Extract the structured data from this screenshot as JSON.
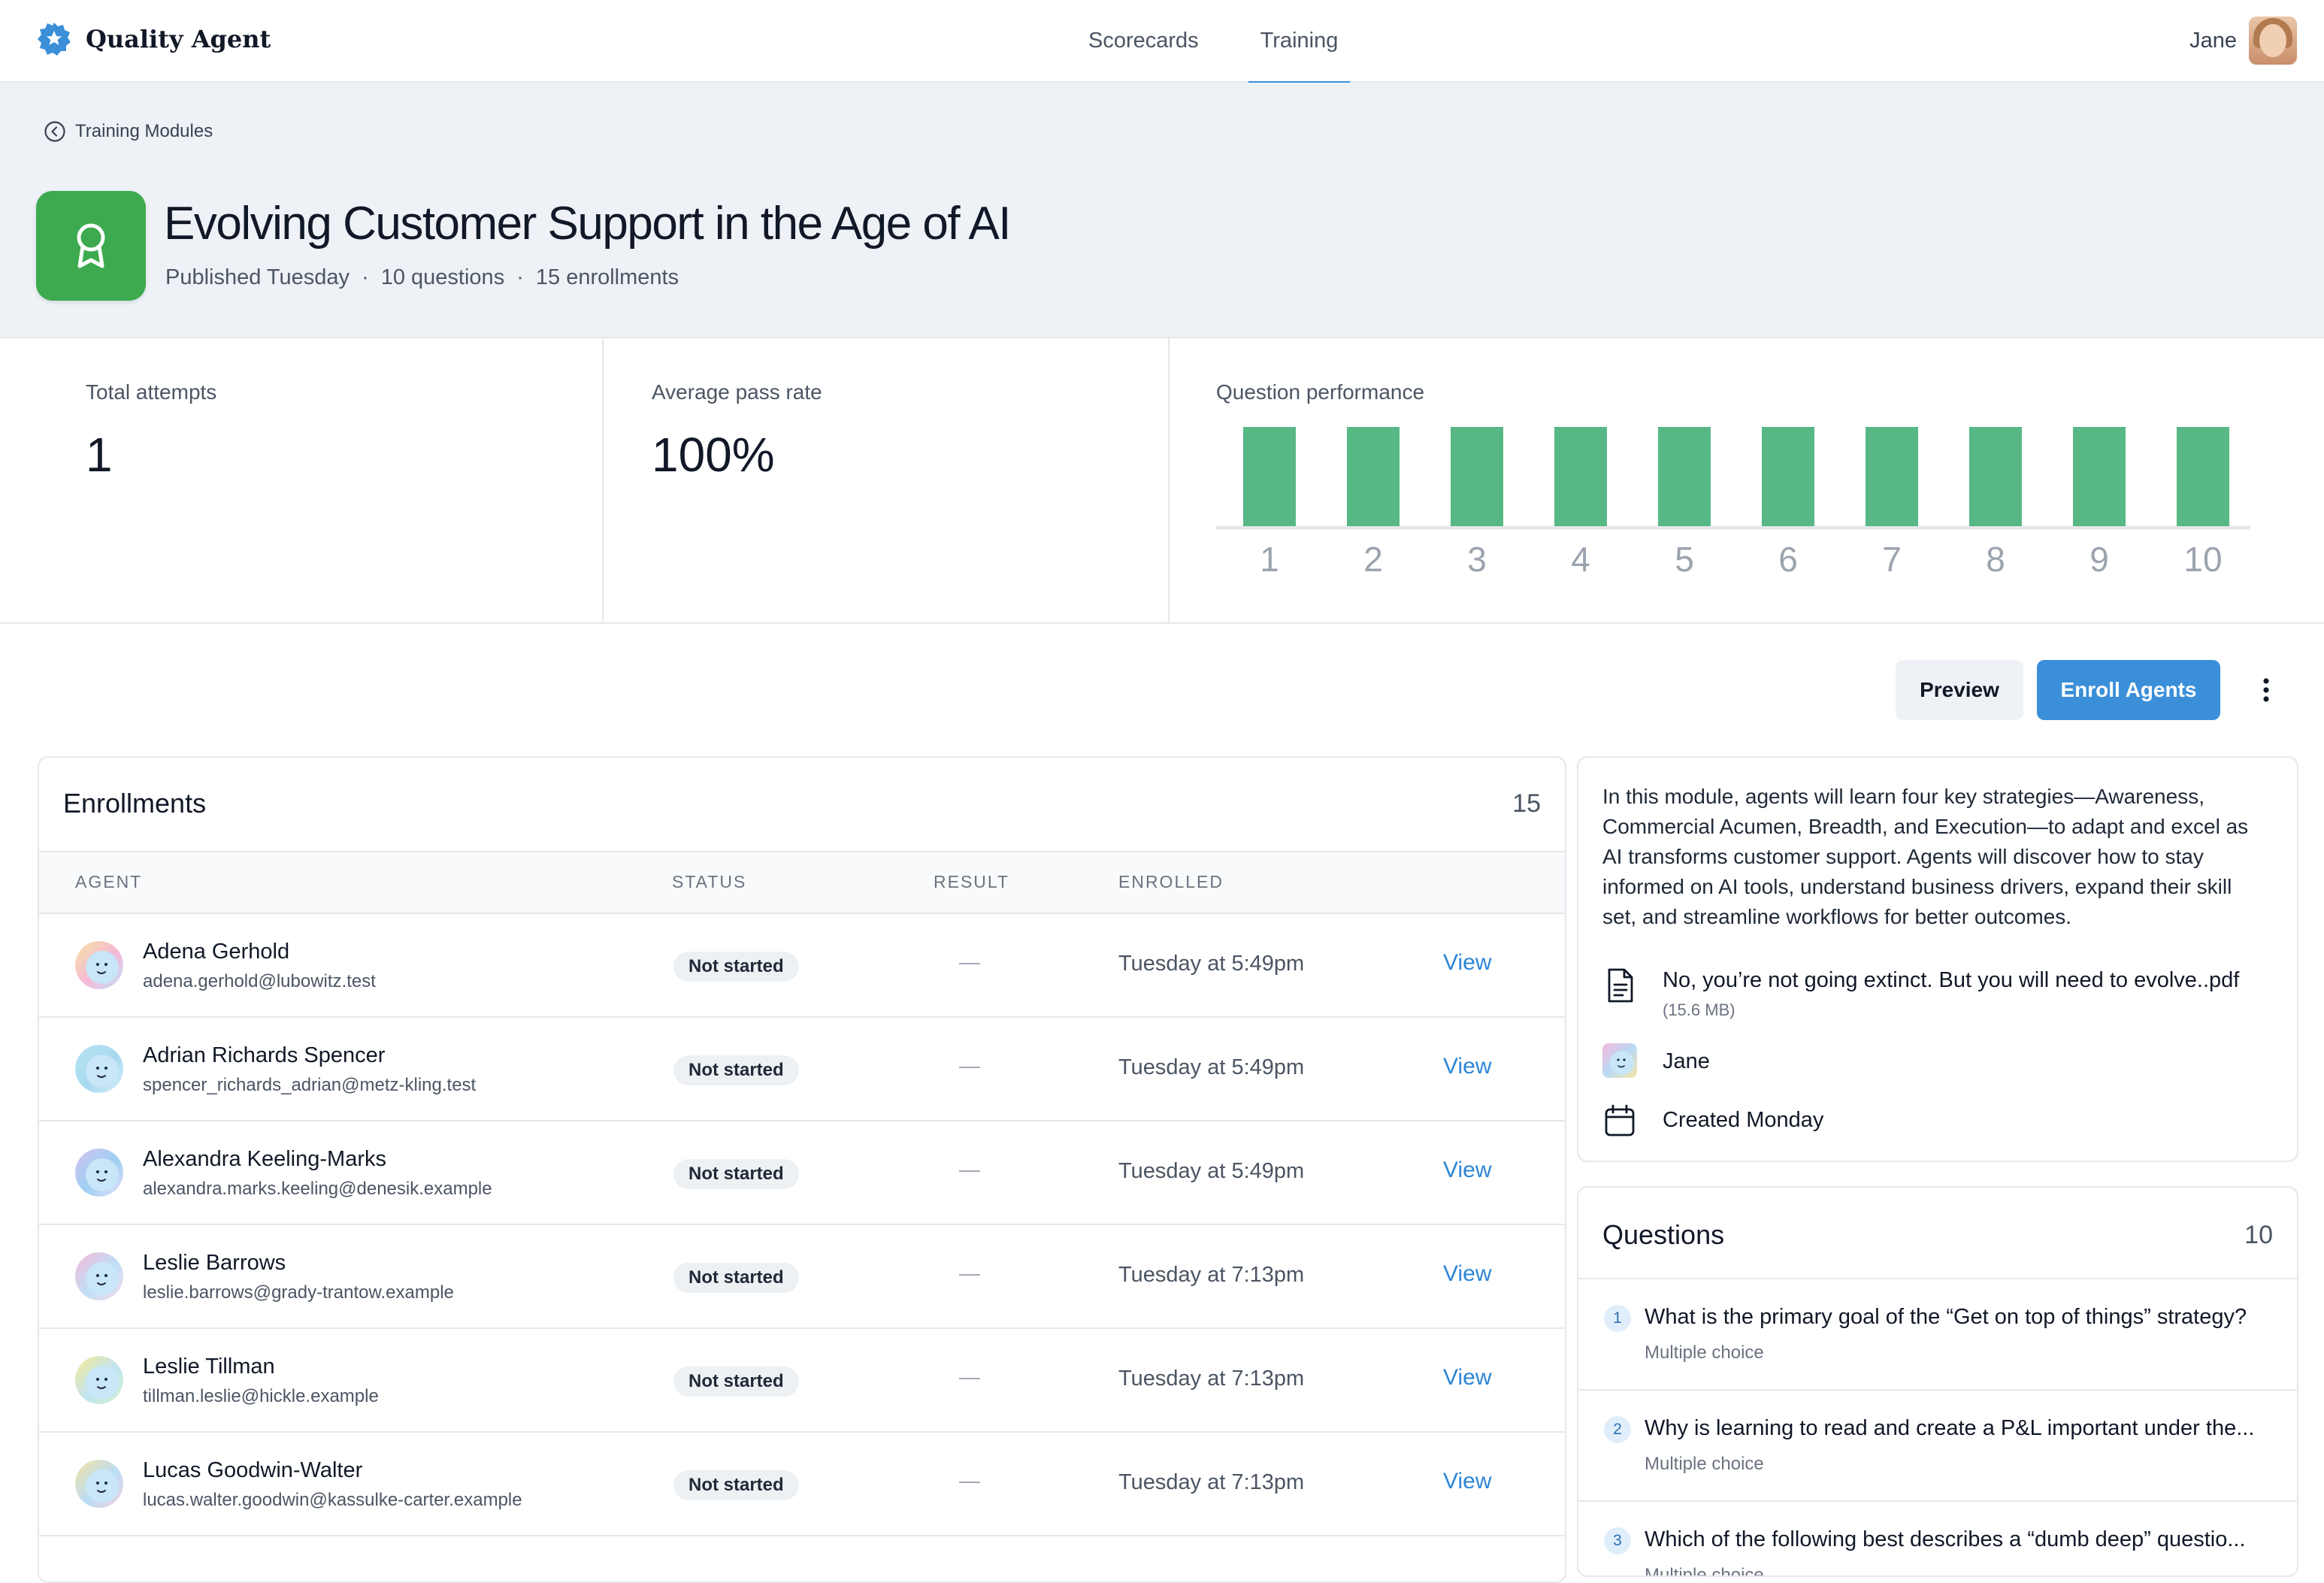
{
  "app": {
    "name": "Quality Agent"
  },
  "nav": {
    "tabs": [
      {
        "label": "Scorecards"
      },
      {
        "label": "Training"
      }
    ]
  },
  "user": {
    "name": "Jane"
  },
  "breadcrumb": {
    "label": "Training Modules"
  },
  "module": {
    "title": "Evolving Customer Support in the Age of AI",
    "published": "Published Tuesday",
    "questions": "10 questions",
    "enrollments": "15 enrollments"
  },
  "stats": {
    "total_attempts_label": "Total attempts",
    "total_attempts_value": "1",
    "pass_rate_label": "Average pass rate",
    "pass_rate_value": "100%",
    "question_performance_label": "Question performance"
  },
  "chart_data": {
    "type": "bar",
    "categories": [
      "1",
      "2",
      "3",
      "4",
      "5",
      "6",
      "7",
      "8",
      "9",
      "10"
    ],
    "values": [
      100,
      100,
      100,
      100,
      100,
      100,
      100,
      100,
      100,
      100
    ],
    "ylim": [
      0,
      100
    ],
    "title": "Question performance",
    "color": "#57b885"
  },
  "actions": {
    "preview": "Preview",
    "enroll": "Enroll Agents"
  },
  "enrollments": {
    "title": "Enrollments",
    "count": "15",
    "columns": [
      "AGENT",
      "STATUS",
      "RESULT",
      "ENROLLED"
    ],
    "rows": [
      {
        "name": "Adena Gerhold",
        "email": "adena.gerhold@lubowitz.test",
        "status": "Not started",
        "result": "—",
        "enrolled": "Tuesday at 5:49pm",
        "action": "View"
      },
      {
        "name": "Adrian Richards Spencer",
        "email": "spencer_richards_adrian@metz-kling.test",
        "status": "Not started",
        "result": "—",
        "enrolled": "Tuesday at 5:49pm",
        "action": "View"
      },
      {
        "name": "Alexandra Keeling-Marks",
        "email": "alexandra.marks.keeling@denesik.example",
        "status": "Not started",
        "result": "—",
        "enrolled": "Tuesday at 5:49pm",
        "action": "View"
      },
      {
        "name": "Leslie Barrows",
        "email": "leslie.barrows@grady-trantow.example",
        "status": "Not started",
        "result": "—",
        "enrolled": "Tuesday at 7:13pm",
        "action": "View"
      },
      {
        "name": "Leslie Tillman",
        "email": "tillman.leslie@hickle.example",
        "status": "Not started",
        "result": "—",
        "enrolled": "Tuesday at 7:13pm",
        "action": "View"
      },
      {
        "name": "Lucas Goodwin-Walter",
        "email": "lucas.walter.goodwin@kassulke-carter.example",
        "status": "Not started",
        "result": "—",
        "enrolled": "Tuesday at 7:13pm",
        "action": "View"
      }
    ]
  },
  "info": {
    "description": "In this module, agents will learn four key strategies—Awareness, Commercial Acumen, Breadth, and Execution—to adapt and excel as AI transforms customer support. Agents will discover how to stay informed on AI tools, understand business drivers, expand their skill set, and streamline workflows for better outcomes.",
    "attachment_name": "No, you’re not going extinct. But you will need to evolve..pdf",
    "attachment_size": "(15.6 MB)",
    "author": "Jane",
    "created": "Created Monday"
  },
  "questions": {
    "title": "Questions",
    "count": "10",
    "items": [
      {
        "num": "1",
        "text": "What is the primary goal of the “Get on top of things” strategy?",
        "type": "Multiple choice"
      },
      {
        "num": "2",
        "text": "Why is learning to read and create a P&L important under the...",
        "type": "Multiple choice"
      },
      {
        "num": "3",
        "text": "Which of the following best describes a “dumb deep” questio...",
        "type": "Multiple choice"
      }
    ]
  }
}
